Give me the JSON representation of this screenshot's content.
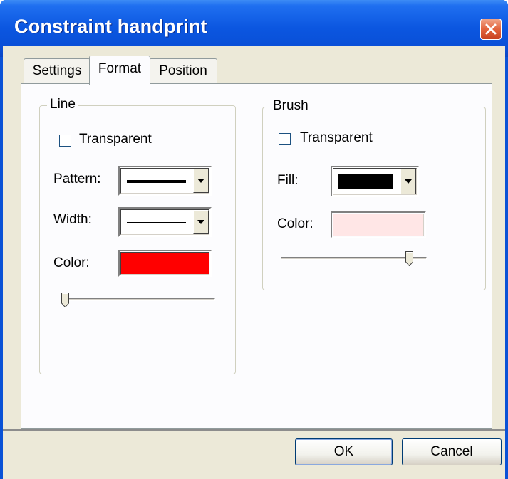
{
  "window": {
    "title": "Constraint handprint"
  },
  "tabs": [
    {
      "label": "Settings"
    },
    {
      "label": "Format"
    },
    {
      "label": "Position"
    }
  ],
  "line_group": {
    "legend": "Line",
    "transparent_label": "Transparent",
    "transparent_checked": false,
    "pattern_label": "Pattern:",
    "width_label": "Width:",
    "color_label": "Color:",
    "color_value": "#ff0000",
    "slider_level": 0
  },
  "brush_group": {
    "legend": "Brush",
    "transparent_label": "Transparent",
    "transparent_checked": false,
    "fill_label": "Fill:",
    "fill_value": "#000000",
    "color_label": "Color:",
    "color_value": "#ffe6e6",
    "slider_level": 0.9
  },
  "buttons": {
    "ok": "OK",
    "cancel": "Cancel"
  },
  "icons": {
    "close": "close-icon",
    "dropdown": "chevron-down-icon"
  }
}
